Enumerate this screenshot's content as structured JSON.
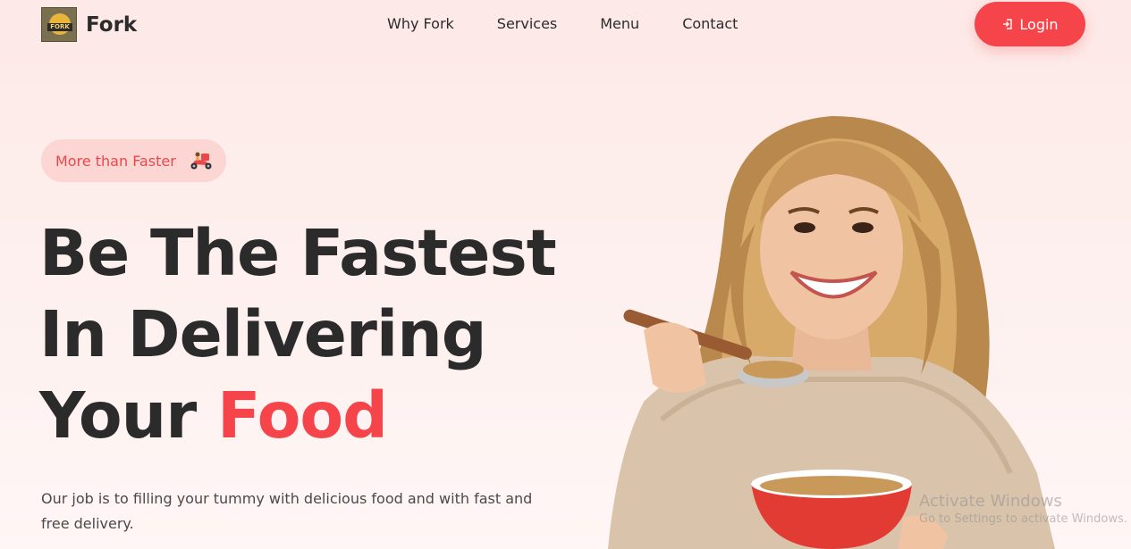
{
  "brand": {
    "name": "Fork",
    "logo_text": "FORK"
  },
  "nav": {
    "links": [
      "Why Fork",
      "Services",
      "Menu",
      "Contact"
    ],
    "login_label": "Login"
  },
  "hero": {
    "badge_text": "More than Faster",
    "headline_line1": "Be The Fastest",
    "headline_line2": "In Delivering",
    "headline_line3_plain": "Your ",
    "headline_line3_accent": "Food",
    "description": "Our job is to filling your tummy with delicious food and with fast and free delivery."
  },
  "watermark": {
    "line1": "Activate Windows",
    "line2": "Go to Settings to activate Windows."
  },
  "colors": {
    "accent": "#f5444a",
    "badge_bg": "#fcd6d3",
    "text_dark": "#2b2b2b"
  },
  "icons": {
    "login": "login-icon",
    "badge": "scooter-icon"
  }
}
